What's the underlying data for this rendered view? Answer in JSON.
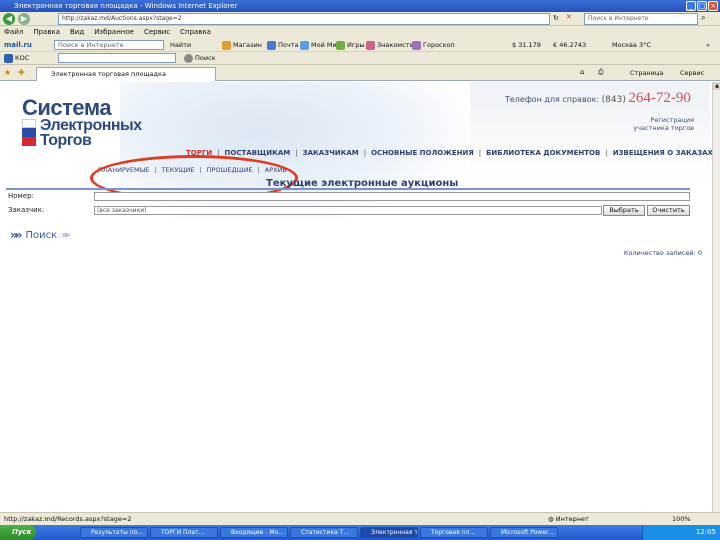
{
  "window": {
    "title": "Электронная торговая площадка - Windows Internet Explorer"
  },
  "address": {
    "url": "http://zakaz.md/Auctions.aspx?stage=2",
    "search_placeholder": "Поиск в Интернете"
  },
  "menu": [
    "Файл",
    "Правка",
    "Вид",
    "Избранное",
    "Сервис",
    "Справка"
  ],
  "toolbar1": {
    "mail_logo": "mail.ru",
    "search_placeholder": "Поиск в Интернете",
    "find_label": "Найти",
    "items": [
      "Магазин",
      "Почта",
      "Мой Мир",
      "Игры",
      "Знакомства",
      "Гороскоп"
    ],
    "rates": [
      "$ 31.179",
      "€ 46.2743"
    ],
    "weather": "Москва 3°C"
  },
  "toolbar2": {
    "app": "КОС",
    "search_label": "Поиск"
  },
  "tab": {
    "title": "Электронная торговая площадка",
    "right_items": [
      "Страница",
      "Сервис"
    ]
  },
  "page": {
    "logo": {
      "line1": "Система",
      "line2": "Электронных",
      "line3": "Торгов"
    },
    "phone": {
      "label": "Телефон для справок:",
      "code": "(843)",
      "number": "264-72-90"
    },
    "register_link": "Регистрация участника торгов",
    "main_nav": [
      {
        "label": "ТОРГИ",
        "active": true
      },
      {
        "label": "ПОСТАВЩИКАМ",
        "active": false
      },
      {
        "label": "ЗАКАЗЧИКАМ",
        "active": false
      },
      {
        "label": "ОСНОВНЫЕ ПОЛОЖЕНИЯ",
        "active": false
      },
      {
        "label": "БИБЛИОТЕКА ДОКУМЕНТОВ",
        "active": false
      },
      {
        "label": "ИЗВЕЩЕНИЯ О ЗАКАЗАХ",
        "active": false
      }
    ],
    "sub_nav": [
      "ПЛАНИРУЕМЫЕ",
      "ТЕКУЩИЕ",
      "ПРОШЕДШИЕ",
      "АРХИВ"
    ],
    "title": "Текущие электронные аукционы",
    "form": {
      "number_label": "Номер:",
      "number_value": "",
      "customer_label": "Заказчик:",
      "customer_value": "(все заказчики)",
      "select_button": "Выбрать",
      "clear_button": "Очистить"
    },
    "search_toggle": "Поиск",
    "records_count": "Количество записей: 0"
  },
  "status": {
    "url": "http://zakaz.md/Records.aspx?stage=2",
    "zone": "Интернет",
    "zoom": "100%"
  },
  "taskbar": {
    "start": "Пуск",
    "tasks": [
      "Результаты по...",
      "ТОРГИ Плат...",
      "Входящие - Mo...",
      "Статистика Т...",
      "Электронная то...",
      "Торговая пл...",
      "Microsoft Power..."
    ],
    "clock": "12:05"
  },
  "colors": {
    "accent": "#2e3f6b",
    "highlight": "#c9303a",
    "phone": "#d25050",
    "oval": "#e03a20"
  }
}
